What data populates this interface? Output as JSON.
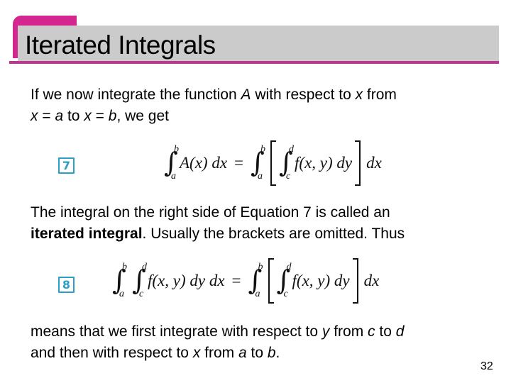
{
  "slide": {
    "title": "Iterated Integrals",
    "page_number": "32",
    "colors": {
      "accent_pink": "#d4268f",
      "title_bar_gray": "#cbcbcb",
      "title_rule": "#b8398e",
      "equation_label": "#2e9fc4"
    }
  },
  "paragraph1": {
    "t1": "If we now integrate the function ",
    "v1": "A",
    "t2": " with respect to ",
    "v2": "x",
    "t3": " from",
    "v3": "x",
    "t4": " = ",
    "v4": "a",
    "t5": " to ",
    "v5": "x",
    "t6": " = ",
    "v6": "b",
    "t7": ", we get"
  },
  "equation7": {
    "label": "7",
    "lhs_upper": "b",
    "lhs_lower": "a",
    "lhs_integrand": "A(x) dx",
    "equals": "=",
    "outer_upper": "b",
    "outer_lower": "a",
    "inner_upper": "d",
    "inner_lower": "c",
    "inner_integrand": "f(x, y) dy",
    "outer_diff": "dx"
  },
  "paragraph2": {
    "t1": "The integral on the right side of Equation 7 is called an",
    "bold": "iterated integral",
    "t2": ". Usually the brackets are omitted. Thus"
  },
  "equation8": {
    "label": "8",
    "lhs_outer_upper": "b",
    "lhs_outer_lower": "a",
    "lhs_inner_upper": "d",
    "lhs_inner_lower": "c",
    "lhs_integrand": "f(x, y) dy dx",
    "equals": "=",
    "outer_upper": "b",
    "outer_lower": "a",
    "inner_upper": "d",
    "inner_lower": "c",
    "inner_integrand": "f(x, y) dy",
    "outer_diff": "dx"
  },
  "paragraph3": {
    "t1": "means that we first integrate with respect to ",
    "v1": "y",
    "t2": " from ",
    "v2": "c",
    "t3": " to ",
    "v3": "d",
    "t4": "and then with respect to ",
    "v4": "x",
    "t5": " from ",
    "v5": "a",
    "t6": " to ",
    "v6": "b",
    "t7": "."
  }
}
